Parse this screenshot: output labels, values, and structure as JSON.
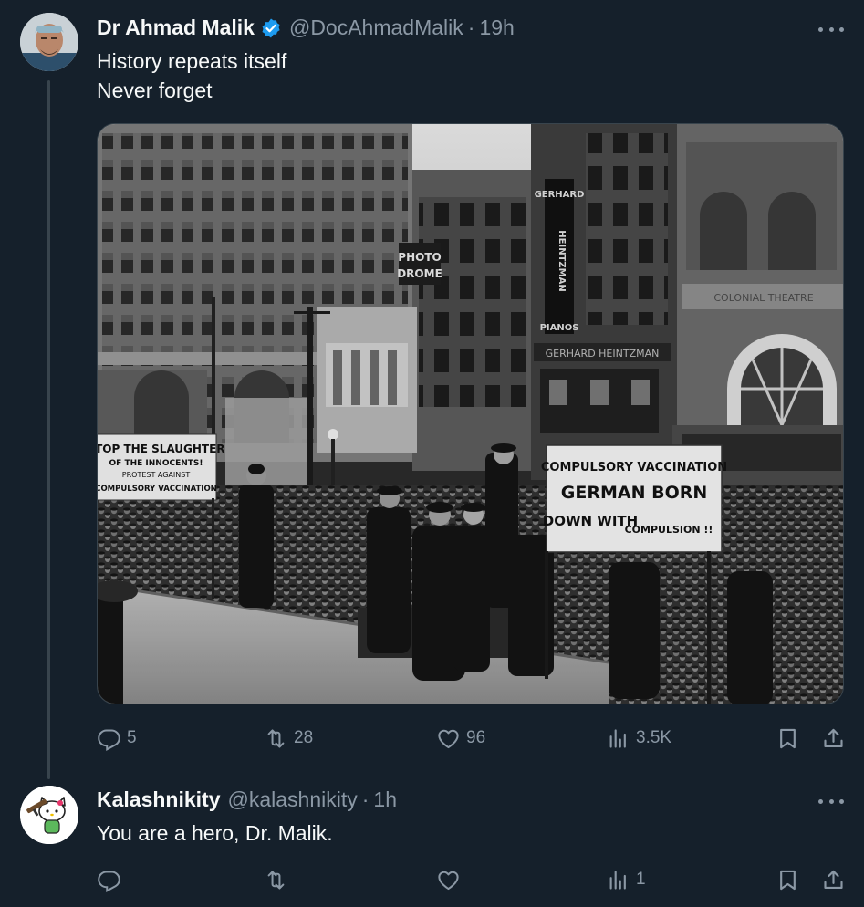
{
  "tweet": {
    "author_name": "Dr Ahmad Malik",
    "handle": "@DocAhmadMalik",
    "separator": "·",
    "time": "19h",
    "text_line1": "History repeats itself",
    "text_line2": "Never forget",
    "media": {
      "sign_left_line1": "STOP THE SLAUGHTER",
      "sign_left_line2": "OF THE INNOCENTS!",
      "sign_left_line3": "PROTEST AGAINST",
      "sign_left_line4": "COMPULSORY VACCINATION",
      "sign_right_line1": "COMPULSORY VACCINATION",
      "sign_right_line2": "GERMAN BORN",
      "sign_right_line3": "DOWN WITH",
      "sign_right_line4": "COMPULSION !!",
      "building_sign_photo1": "PHOTO",
      "building_sign_photo2": "DROME",
      "building_sign_gerhard": "GERHARD",
      "building_sign_heintzman": "HEINTZMAN",
      "building_sign_pianos": "PIANOS",
      "building_sign_theatre": "COLONIAL THEATRE",
      "building_sign_store": "GERHARD HEINTZMAN"
    },
    "stats": {
      "replies": "5",
      "retweets": "28",
      "likes": "96",
      "views": "3.5K"
    }
  },
  "reply": {
    "author_name": "Kalashnikity",
    "handle": "@kalashnikity",
    "separator": "·",
    "time": "1h",
    "text": "You are a hero, Dr. Malik.",
    "stats": {
      "views": "1"
    }
  },
  "colors": {
    "background": "#15202b",
    "secondary_text": "#8b98a5",
    "verified_blue": "#1d9bf0",
    "thread_line": "#38444d"
  },
  "icons": [
    "reply-icon",
    "retweet-icon",
    "like-icon",
    "views-icon",
    "bookmark-icon",
    "share-icon",
    "verified-icon",
    "more-icon"
  ]
}
